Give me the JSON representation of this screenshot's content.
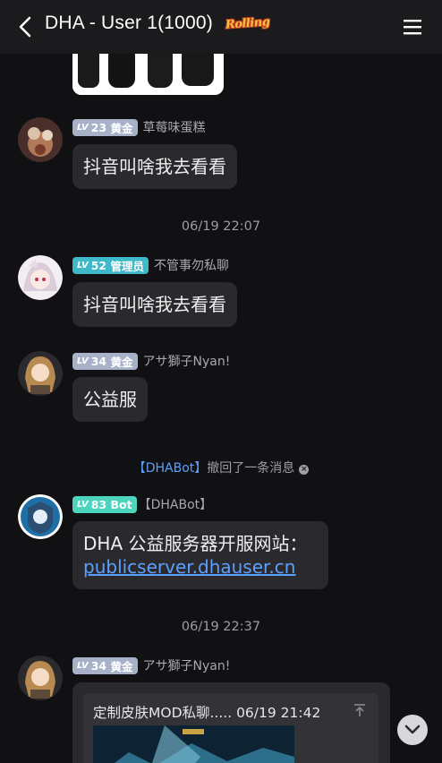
{
  "header": {
    "title": "DHA - User 1(1000)",
    "badge": "Rolling"
  },
  "messages": [
    {
      "nickname": "草莓味蛋糕",
      "level": "23",
      "rank": "黄金",
      "text": "抖音叫啥我去看看"
    },
    {
      "nickname": "不管事勿私聊",
      "level": "52",
      "rank": "管理员",
      "text": "抖音叫啥我去看看"
    },
    {
      "nickname": "アサ獅子Nyan!",
      "level": "34",
      "rank": "黄金",
      "text": "公益服"
    },
    {
      "nickname": "【DHABot】",
      "level": "83",
      "rank": "Bot",
      "text": "DHA 公益服务器开服网站：",
      "link": "publicserver.dhauser.cn"
    },
    {
      "nickname": "アサ獅子Nyan!",
      "level": "34",
      "rank": "黄金",
      "card_title": "定制皮肤MOD私聊..... 06/19 21:42"
    }
  ],
  "timestamps": [
    "06/19 22:07",
    "06/19 22:37"
  ],
  "system": {
    "who": "【DHABot】",
    "action": "撤回了一条消息"
  },
  "level_prefix": "LV",
  "colors": {
    "background": "#111113",
    "bubble": "#2a2a2e",
    "link": "#5aa0ff",
    "badge_gold": "#a7b2c9",
    "badge_admin": "#3fb8c9",
    "badge_bot": "#4cd4bf"
  }
}
